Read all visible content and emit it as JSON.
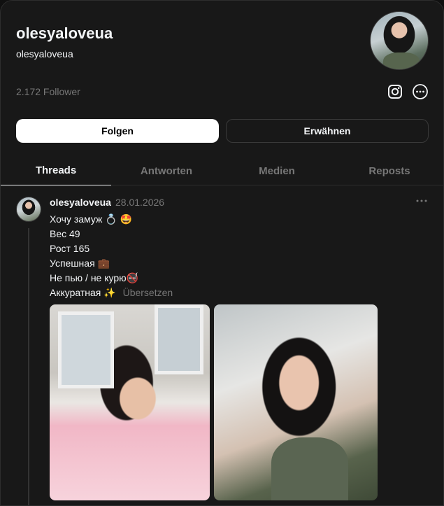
{
  "profile": {
    "name": "olesyaloveua",
    "handle": "olesyaloveua",
    "followers": "2.172 Follower"
  },
  "actions": {
    "follow_label": "Folgen",
    "mention_label": "Erwähnen"
  },
  "tabs": [
    {
      "label": "Threads",
      "active": true
    },
    {
      "label": "Antworten",
      "active": false
    },
    {
      "label": "Medien",
      "active": false
    },
    {
      "label": "Reposts",
      "active": false
    }
  ],
  "post": {
    "author": "olesyaloveua",
    "date": "28.01.2026",
    "lines": [
      "Хочу замуж 💍 🤩",
      "Вес 49",
      "Рост 165",
      "Успешная 💼",
      "Не пью / не курю🚭",
      "Аккуратная ✨"
    ],
    "translate_label": "Übersetzen"
  },
  "icons": {
    "instagram": "instagram-icon",
    "more": "more-horizontal-icon"
  },
  "colors": {
    "background": "#181818",
    "muted_text": "#777777",
    "primary_text": "#f3f5f7",
    "border": "#2d2d2d"
  }
}
